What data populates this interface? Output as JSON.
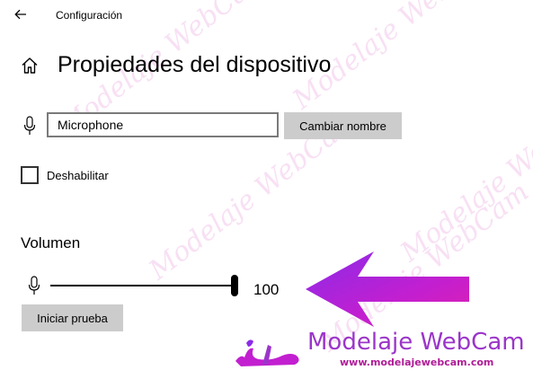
{
  "header": {
    "back_icon": "arrow-left-icon",
    "app_title": "Configuración"
  },
  "page": {
    "home_icon": "home-icon",
    "title": "Propiedades del dispositivo"
  },
  "device": {
    "mic_icon": "microphone-icon",
    "name_value": "Microphone",
    "rename_label": "Cambiar nombre",
    "disable_label": "Deshabilitar",
    "disable_checked": false
  },
  "volume": {
    "heading": "Volumen",
    "mic_icon": "microphone-icon",
    "level": 100,
    "value_text": "100",
    "test_label": "Iniciar prueba"
  },
  "overlay": {
    "arrow_color": "#b31fd6",
    "watermark_text": "Modelaje WebCam"
  },
  "branding": {
    "logo_icon": "reclining-woman-silhouette-logo",
    "name": "Modelaje WebCam",
    "url": "www.modelajewebcam.com",
    "name_color": "#9b35c9",
    "url_color": "#b01c98"
  },
  "colors": {
    "button_bg": "#cccccc",
    "input_border": "#7a7a7a",
    "text": "#000000"
  }
}
